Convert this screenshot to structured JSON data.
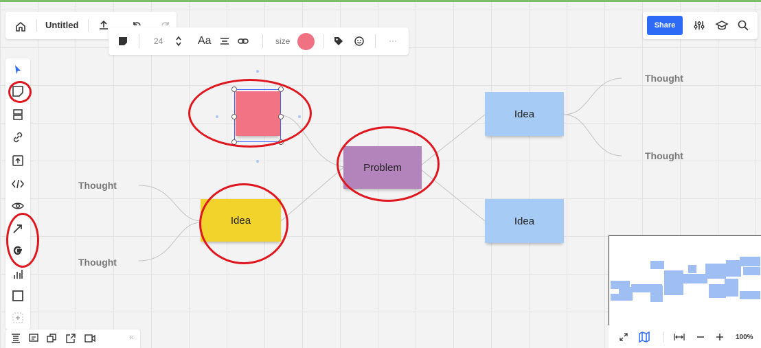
{
  "board": {
    "title": "Untitled"
  },
  "header": {
    "share_label": "Share"
  },
  "format_toolbar": {
    "font_size": "24",
    "font_label": "Aa",
    "size_label": "size",
    "more_label": "···",
    "color": "#f07182"
  },
  "sticky_notes": [
    {
      "label": "",
      "color": "#f27384"
    },
    {
      "label": "Problem",
      "color": "#b384bb"
    },
    {
      "label": "Idea",
      "color": "#f2d32c"
    },
    {
      "label": "Idea",
      "color": "#a6ccf5"
    },
    {
      "label": "Idea",
      "color": "#a6ccf5"
    }
  ],
  "thoughts": [
    "Thought",
    "Thought",
    "Thought",
    "Thought"
  ],
  "left_toolbar": {
    "tools": [
      "select-tool",
      "sticky-note-tool",
      "templates-tool",
      "link-tool",
      "upload-tool",
      "embed-tool",
      "reactions-tool",
      "arrow-tool",
      "google-tool",
      "chart-tool",
      "frame-tool",
      "more-tools"
    ]
  },
  "bottom_toolbar": {
    "collapse_label": "«"
  },
  "navigator": {
    "zoom_label": "100%"
  },
  "colors": {
    "accent": "#2d6af6",
    "highlight_red": "#e0161e",
    "topline": "#7bbf6a"
  }
}
